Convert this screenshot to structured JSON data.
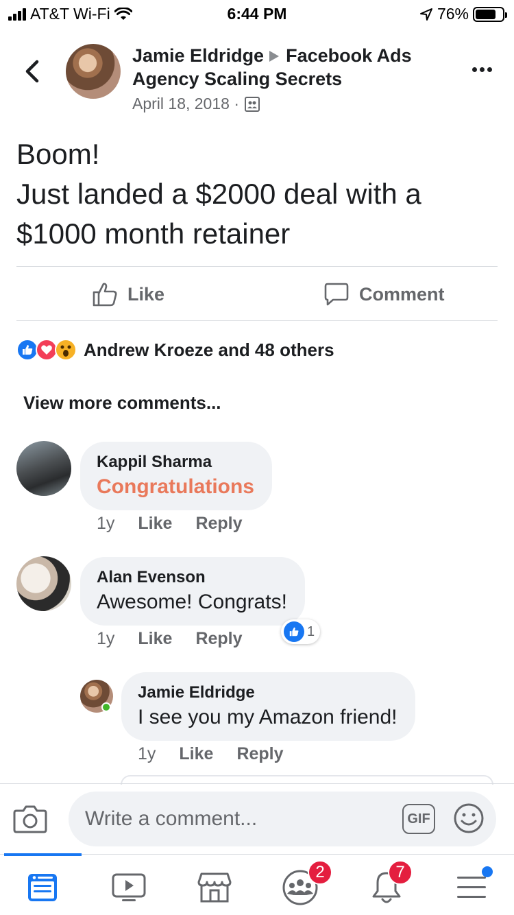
{
  "status_bar": {
    "carrier": "AT&T Wi-Fi",
    "time": "6:44 PM",
    "battery": "76%",
    "battery_level": 0.76
  },
  "post": {
    "author": "Jamie Eldridge",
    "group": "Facebook Ads Agency Scaling Secrets",
    "group_line1": "Facebook Ads",
    "group_line2": "Agency Scaling Secrets",
    "date": "April 18, 2018 ·",
    "text_lines": [
      "Boom!",
      "Just landed a $2000 deal with a",
      "$1000 month retainer"
    ],
    "like_label": "Like",
    "comment_label": "Comment",
    "reactions_text": "Andrew Kroeze and 48 others",
    "view_more": "View more comments..."
  },
  "comments": [
    {
      "name": "Kappil Sharma",
      "text": "Congratulations",
      "age": "1y",
      "like": "Like",
      "reply": "Reply"
    },
    {
      "name": "Alan Evenson",
      "text": "Awesome! Congrats!",
      "age": "1y",
      "like": "Like",
      "reply": "Reply",
      "reaction_count": "1"
    },
    {
      "name": "Jamie Eldridge",
      "text": "I see you my Amazon friend!",
      "age": "1y",
      "like": "Like",
      "reply": "Reply"
    }
  ],
  "composer": {
    "placeholder": "Write a comment...",
    "gif_label": "GIF"
  },
  "tabbar": {
    "groups_badge": "2",
    "notifications_badge": "7"
  },
  "colors": {
    "accent": "#1877f2",
    "badge": "#e41e3f",
    "highlight_text": "#e9795b"
  }
}
